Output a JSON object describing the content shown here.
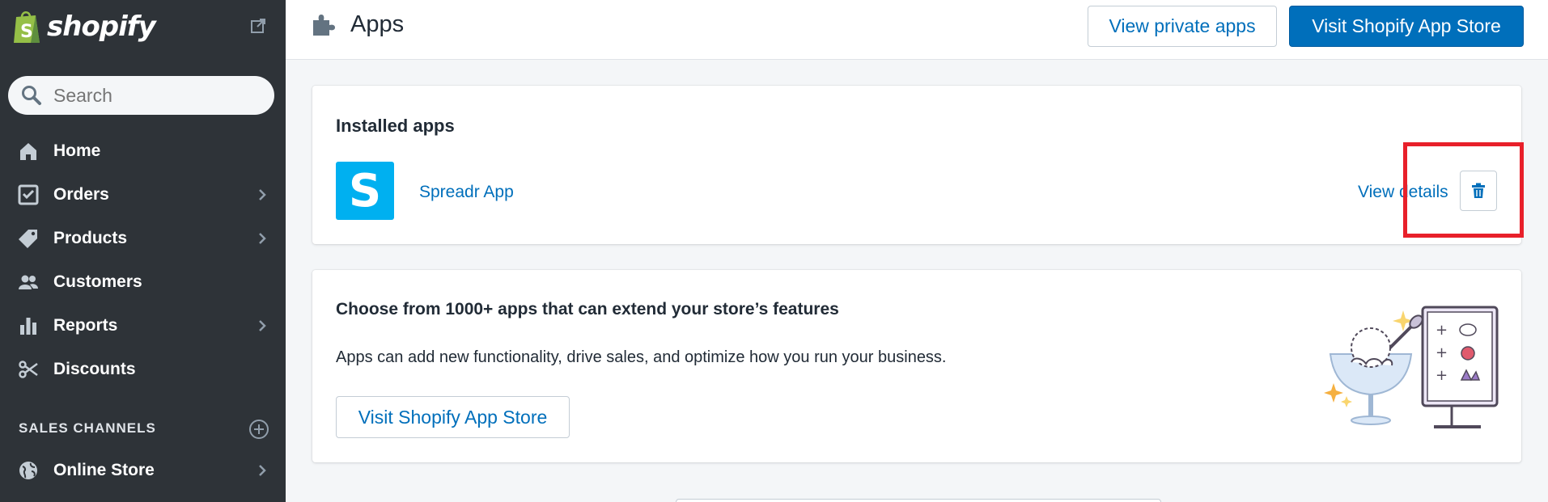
{
  "sidebar": {
    "brand": "shopify",
    "search": {
      "placeholder": "Search"
    },
    "items": [
      {
        "label": "Home",
        "icon": "home-icon",
        "has_chevron": false
      },
      {
        "label": "Orders",
        "icon": "orders-icon",
        "has_chevron": true
      },
      {
        "label": "Products",
        "icon": "tag-icon",
        "has_chevron": true
      },
      {
        "label": "Customers",
        "icon": "customers-icon",
        "has_chevron": false
      },
      {
        "label": "Reports",
        "icon": "bar-chart-icon",
        "has_chevron": true
      },
      {
        "label": "Discounts",
        "icon": "discount-icon",
        "has_chevron": false
      }
    ],
    "sales_channels_label": "SALES CHANNELS",
    "online_store": {
      "label": "Online Store",
      "icon": "globe-icon"
    }
  },
  "header": {
    "title": "Apps",
    "icon": "puzzle-icon",
    "view_private_label": "View private apps",
    "visit_store_label": "Visit Shopify App Store"
  },
  "installed": {
    "title": "Installed apps",
    "apps": [
      {
        "logo_letter": "S",
        "name": "Spreadr App",
        "details_label": "View details",
        "delete_icon": "trash-icon"
      }
    ]
  },
  "promo": {
    "title": "Choose from 1000+ apps that can extend your store’s features",
    "description": "Apps can add new functionality, drive sales, and optimize how you run your business.",
    "button_label": "Visit Shopify App Store"
  },
  "colors": {
    "sidebar_bg": "#2e3338",
    "accent": "#006fbb",
    "highlight": "#e8202a",
    "app_logo": "#00b0f0"
  }
}
